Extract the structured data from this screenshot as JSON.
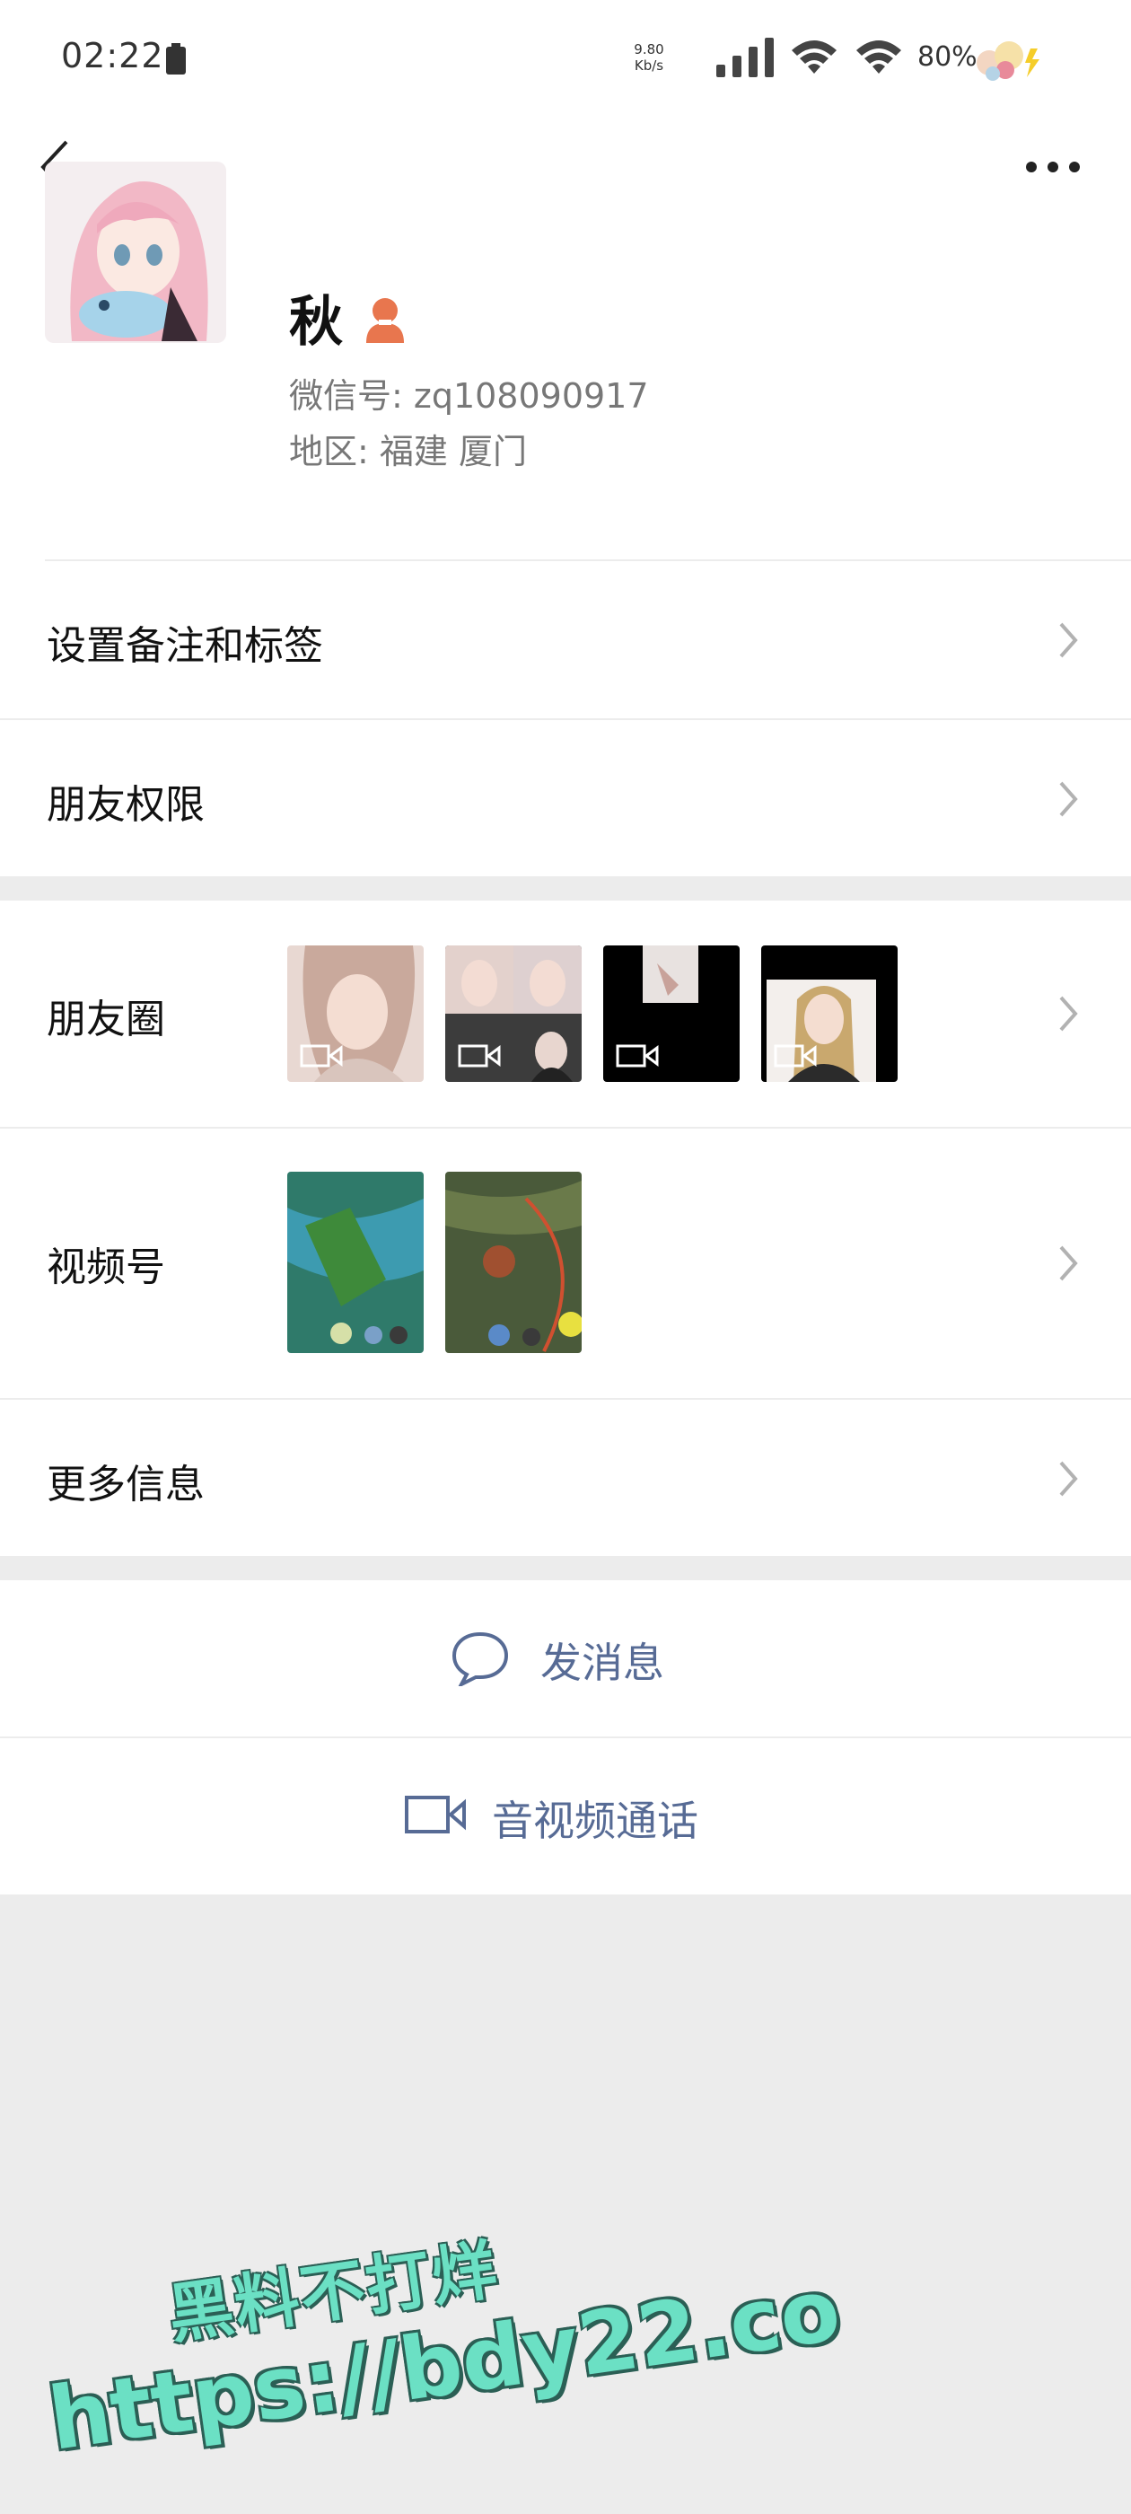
{
  "status_bar": {
    "time": "02:22",
    "net_speed_value": "9.80",
    "net_speed_unit": "Kb/s",
    "battery_percent": "80%"
  },
  "profile": {
    "name": "秋",
    "wechat_id": "微信号: zq108090917",
    "region": "地区: 福建 厦门"
  },
  "rows": {
    "remark_tags": "设置备注和标签",
    "friend_permissions": "朋友权限",
    "moments": "朋友圈",
    "channels": "视频号",
    "more_info": "更多信息"
  },
  "actions": {
    "send_message": "发消息",
    "video_call": "音视频通话"
  },
  "watermark": {
    "line1": "黑料不打烊",
    "line2": "https://bdy22.co"
  },
  "colors": {
    "link": "#576b95",
    "gender_badge": "#e8764e",
    "background": "#ececec"
  },
  "icons": {
    "back": "chevron-left-icon",
    "more": "more-dots-icon",
    "gender": "female-icon",
    "chevron": "chevron-right-icon",
    "message": "chat-bubble-icon",
    "video": "video-camera-icon"
  }
}
